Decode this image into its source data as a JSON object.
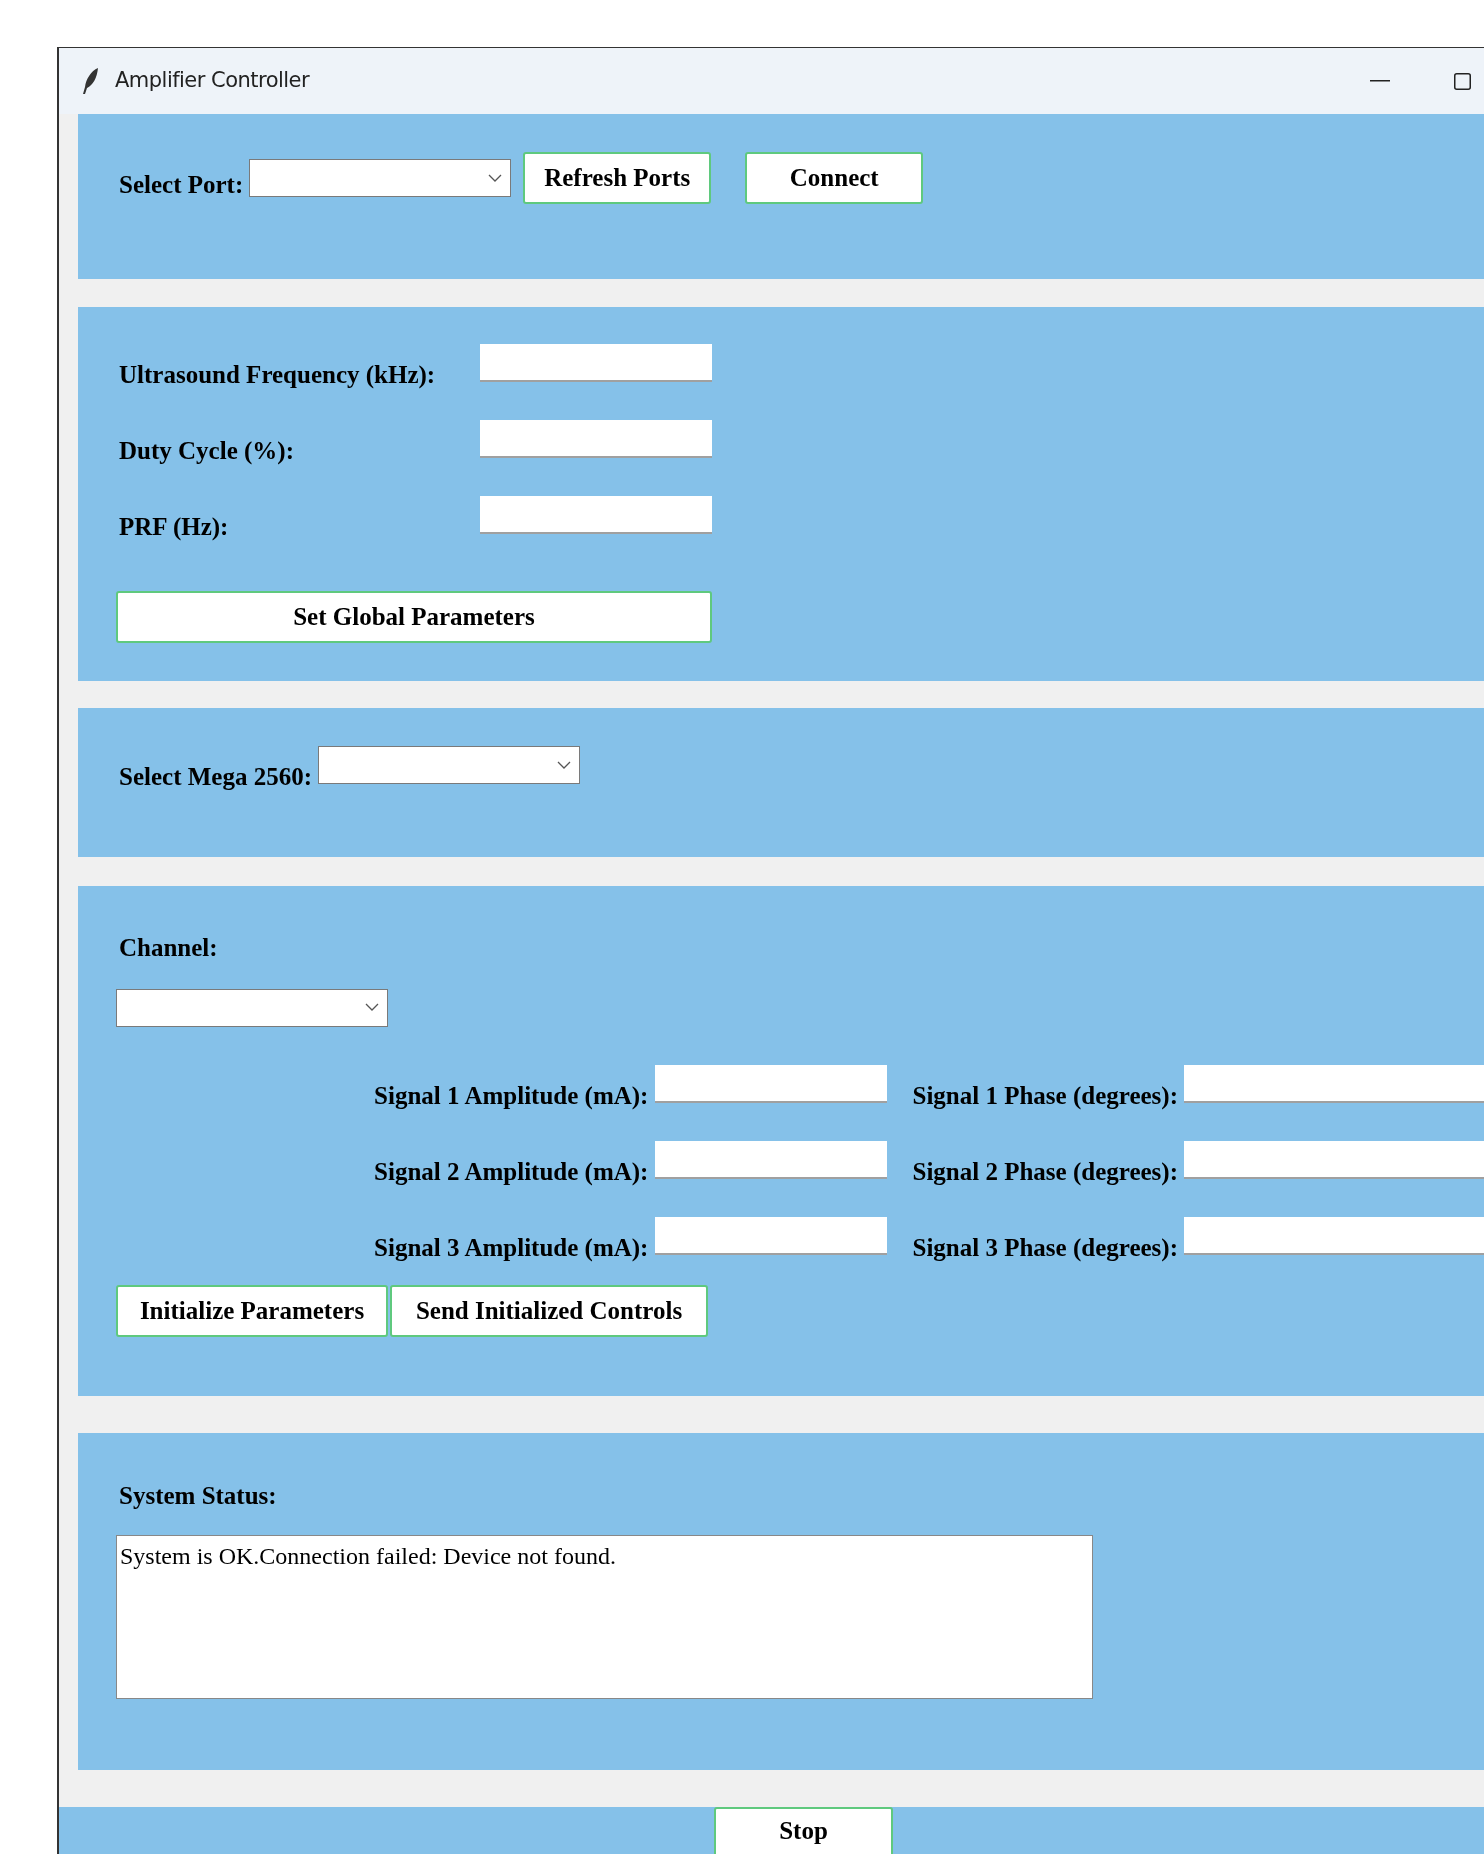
{
  "window": {
    "title": "Amplifier Controller"
  },
  "port_panel": {
    "label": "Select Port:",
    "buttons": [
      "Refresh Ports",
      "Connect"
    ]
  },
  "global_panel": {
    "fields": [
      {
        "label": "Ultrasound Frequency (kHz):"
      },
      {
        "label": "Duty Cycle (%):"
      },
      {
        "label": "PRF (Hz):"
      }
    ],
    "button": "Set Global Parameters"
  },
  "mega_panel": {
    "label": "Select Mega 2560:"
  },
  "channel_panel": {
    "label": "Channel:",
    "signals": [
      {
        "amplitude_label": "Signal 1 Amplitude (mA):",
        "phase_label": "Signal 1 Phase (degrees):"
      },
      {
        "amplitude_label": "Signal 2 Amplitude (mA):",
        "phase_label": "Signal 2 Phase (degrees):"
      },
      {
        "amplitude_label": "Signal 3 Amplitude (mA):",
        "phase_label": "Signal 3 Phase (degrees):"
      }
    ],
    "buttons": [
      "Initialize Parameters",
      "Send Initialized Controls"
    ]
  },
  "status_panel": {
    "label": "System Status:",
    "text": "System is OK.Connection failed: Device not found."
  },
  "stop_button": "Stop"
}
